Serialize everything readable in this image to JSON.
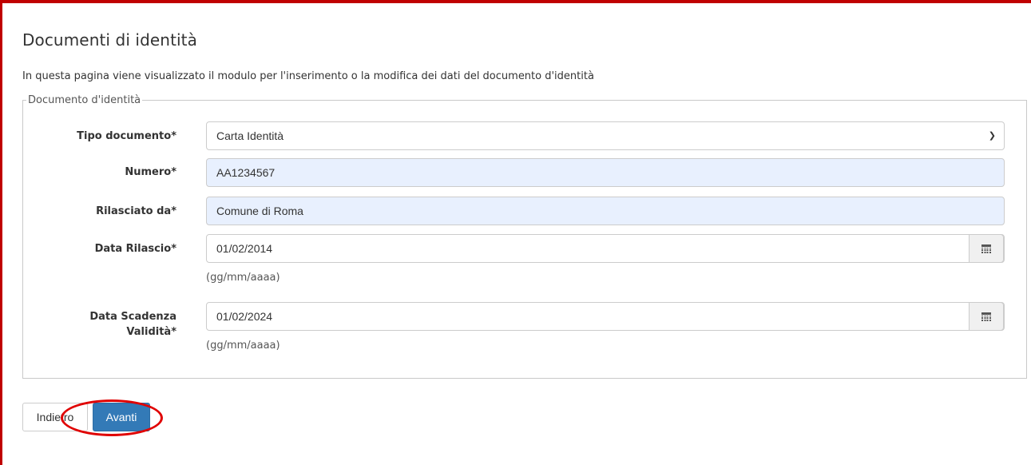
{
  "page": {
    "title": "Documenti di identità",
    "intro": "In questa pagina viene visualizzato il modulo per l'inserimento o la modifica dei dati del documento d'identità"
  },
  "form": {
    "legend": "Documento d'identità",
    "tipo_documento": {
      "label": "Tipo documento*",
      "value": "Carta Identità"
    },
    "numero": {
      "label": "Numero*",
      "value": "AA1234567"
    },
    "rilasciato_da": {
      "label": "Rilasciato da*",
      "value": "Comune di Roma"
    },
    "data_rilascio": {
      "label": "Data Rilascio*",
      "value": "01/02/2014",
      "hint": "(gg/mm/aaaa)"
    },
    "data_scadenza": {
      "label_line1": "Data Scadenza",
      "label_line2": "Validità*",
      "value": "01/02/2024",
      "hint": "(gg/mm/aaaa)"
    }
  },
  "buttons": {
    "back": "Indietro",
    "next": "Avanti"
  },
  "colors": {
    "frame": "#c00000",
    "primary": "#337ab7",
    "autofill": "#e8f0fe",
    "highlight": "#e00000"
  },
  "icons": [
    "calendar-icon",
    "chevron-down-icon"
  ]
}
